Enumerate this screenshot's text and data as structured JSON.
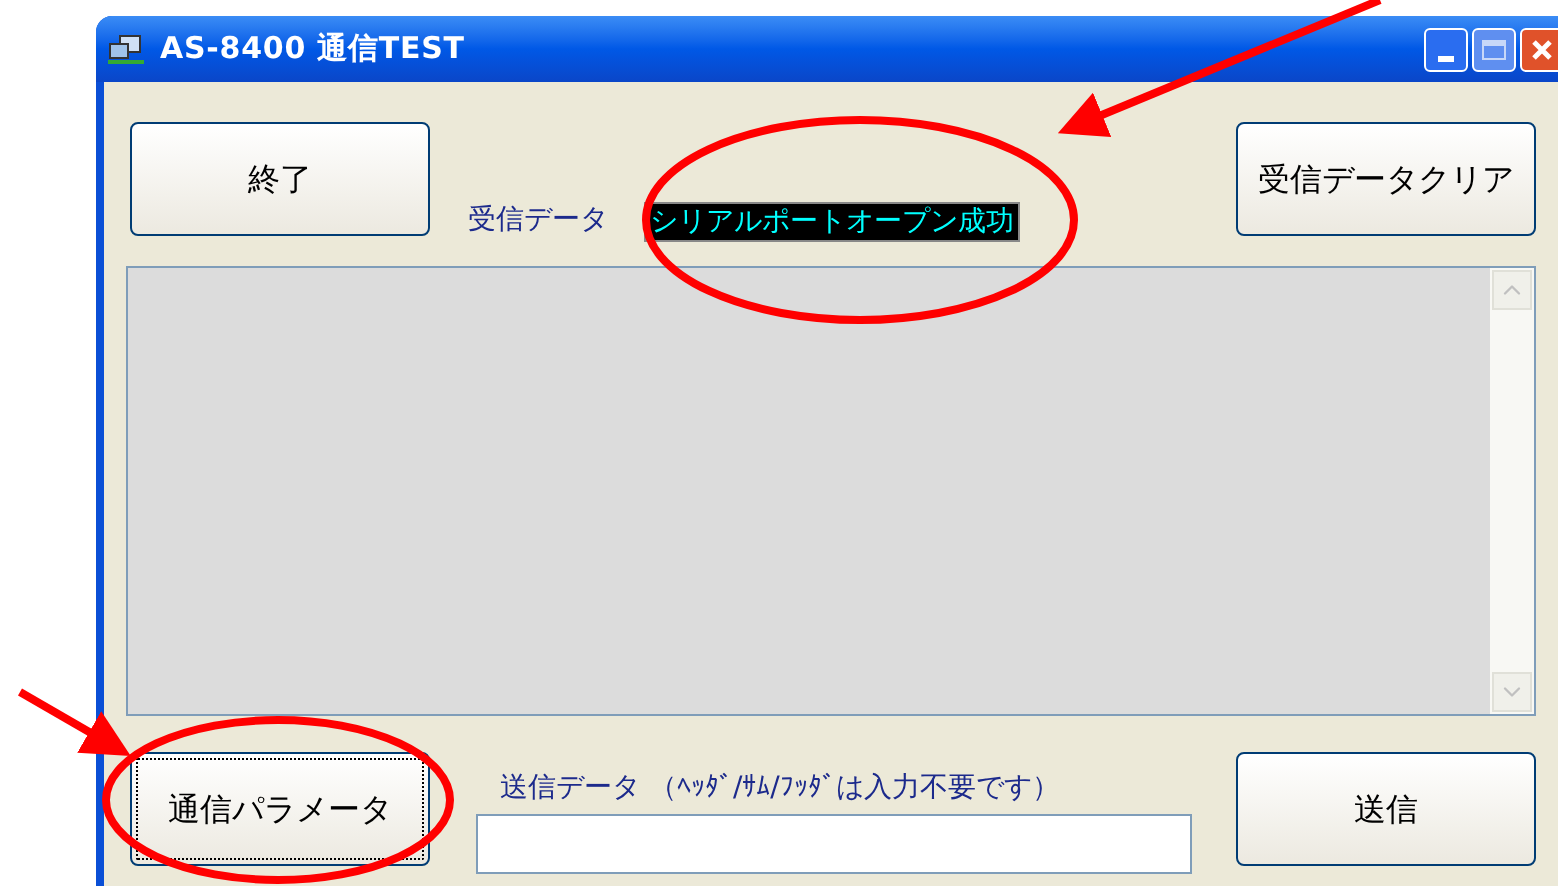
{
  "window": {
    "title": "AS-8400 通信TEST"
  },
  "buttons": {
    "exit": "終了",
    "clear": "受信データクリア",
    "params": "通信パラメータ",
    "send": "送信"
  },
  "receive": {
    "label": "受信データ",
    "status": "シリアルポートオープン成功"
  },
  "send_field": {
    "label": "送信データ （ﾍｯﾀﾞ/ｻﾑ/ﾌｯﾀﾞは入力不要です）"
  }
}
